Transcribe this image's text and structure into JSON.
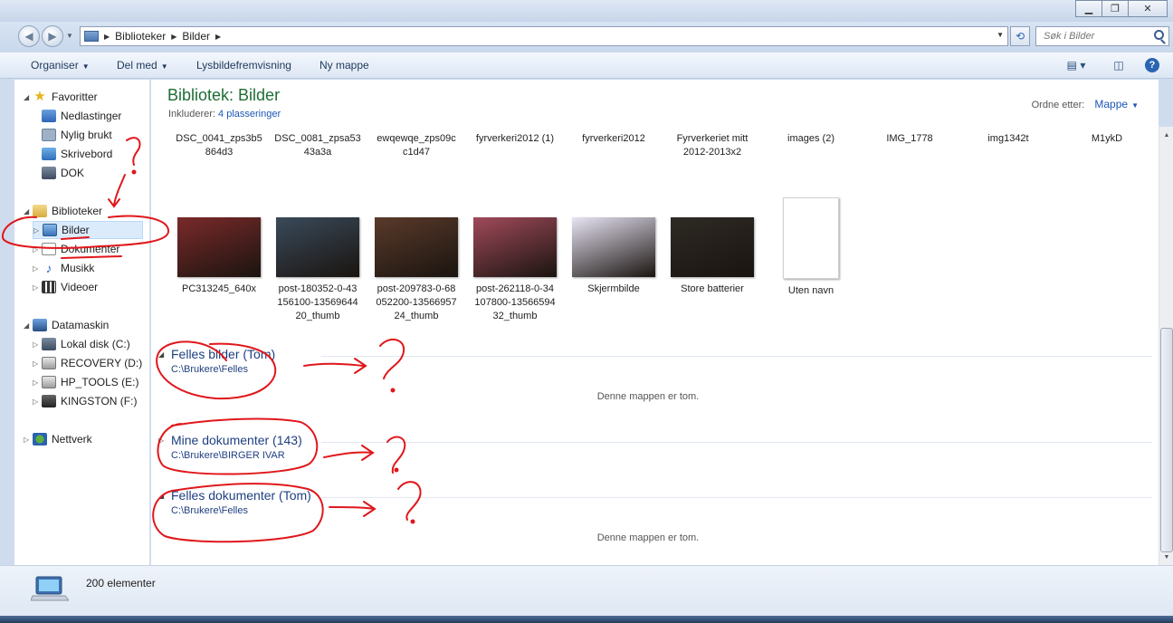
{
  "address": {
    "breadcrumbs": [
      "Biblioteker",
      "Bilder"
    ],
    "search_placeholder": "Søk i Bilder"
  },
  "toolbar": {
    "organize": "Organiser",
    "share": "Del med",
    "slideshow": "Lysbildefremvisning",
    "new_folder": "Ny mappe"
  },
  "nav": {
    "favorites": "Favoritter",
    "downloads": "Nedlastinger",
    "recent": "Nylig brukt",
    "desktop": "Skrivebord",
    "dok": "DOK",
    "libraries": "Biblioteker",
    "pictures": "Bilder",
    "documents": "Dokumenter",
    "music": "Musikk",
    "videos": "Videoer",
    "computer": "Datamaskin",
    "drives": [
      "Lokal disk (C:)",
      "RECOVERY (D:)",
      "HP_TOOLS (E:)",
      "KINGSTON (F:)"
    ],
    "network": "Nettverk"
  },
  "library": {
    "title": "Bibliotek: Bilder",
    "includes_label": "Inkluderer:",
    "includes_link": "4 plasseringer",
    "arrange_label": "Ordne etter:",
    "arrange_value": "Mappe"
  },
  "files_row1": [
    {
      "name": "DSC_0041_zps3b5\n864d3",
      "color": "#6b3a22"
    },
    {
      "name": "DSC_0081_zpsa53\n43a3a",
      "color": "#3c4a7a"
    },
    {
      "name": "ewqewqe_zps09c\nc1d47",
      "color": "#7a4b2a"
    },
    {
      "name": "fyrverkeri2012 (1)",
      "color": "#5a2e20"
    },
    {
      "name": "fyrverkeri2012",
      "color": "#6e3824"
    },
    {
      "name": "Fyrverkeriet mitt\n2012-2013x2",
      "color": "#8a4a22"
    },
    {
      "name": "images (2)",
      "color": "#8c7452"
    },
    {
      "name": "IMG_1778",
      "color": "#5a3022"
    },
    {
      "name": "img1342t",
      "color": "#7a5a2a"
    },
    {
      "name": "M1ykD",
      "color": "#4a2a1e"
    }
  ],
  "files_row2": [
    {
      "name": "PC313245_640x",
      "color": "#7a2a2a"
    },
    {
      "name": "post-180352-0-43\n156100-13569644\n20_thumb",
      "color": "#3a4a5a"
    },
    {
      "name": "post-209783-0-68\n052200-13566957\n24_thumb",
      "color": "#5a3a2a"
    },
    {
      "name": "post-262118-0-34\n107800-13566594\n32_thumb",
      "color": "#a04a5a"
    },
    {
      "name": "Skjermbilde",
      "color": "#e8e4f4"
    },
    {
      "name": "Store batterier",
      "color": "#2e2a24"
    },
    {
      "name": "Uten navn",
      "color": "#ffffff"
    }
  ],
  "groups": [
    {
      "name": "Felles bilder (Tom)",
      "path": "C:\\Brukere\\Felles",
      "expanded": true,
      "empty_msg": "Denne mappen er tom."
    },
    {
      "name": "Mine dokumenter (143)",
      "path": "C:\\Brukere\\BIRGER IVAR",
      "expanded": false
    },
    {
      "name": "Felles dokumenter (Tom)",
      "path": "C:\\Brukere\\Felles",
      "expanded": true,
      "empty_msg": "Denne mappen er tom."
    }
  ],
  "status": {
    "count": "200 elementer"
  },
  "annotations": {
    "question_mark": "?"
  }
}
